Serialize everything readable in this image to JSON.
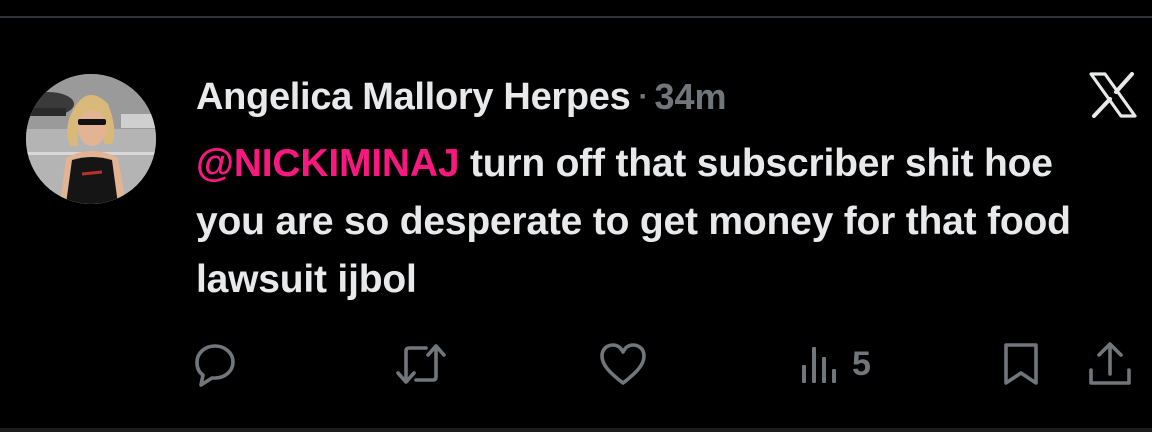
{
  "tweet": {
    "author_name": "Angelica Mallory Herpes",
    "separator": "·",
    "timestamp": "34m",
    "mention": "@NICKIMINAJ",
    "body": " turn off that subscriber shit hoe you are so desperate to get money for that food lawsuit ijbol"
  },
  "actions": {
    "views_count": "5",
    "icons": [
      "reply-icon",
      "retweet-icon",
      "like-icon",
      "views-icon",
      "bookmark-icon",
      "share-icon"
    ]
  },
  "colors": {
    "background": "#000000",
    "text": "#e7e9ea",
    "muted": "#71767b",
    "mention": "#f91880"
  }
}
